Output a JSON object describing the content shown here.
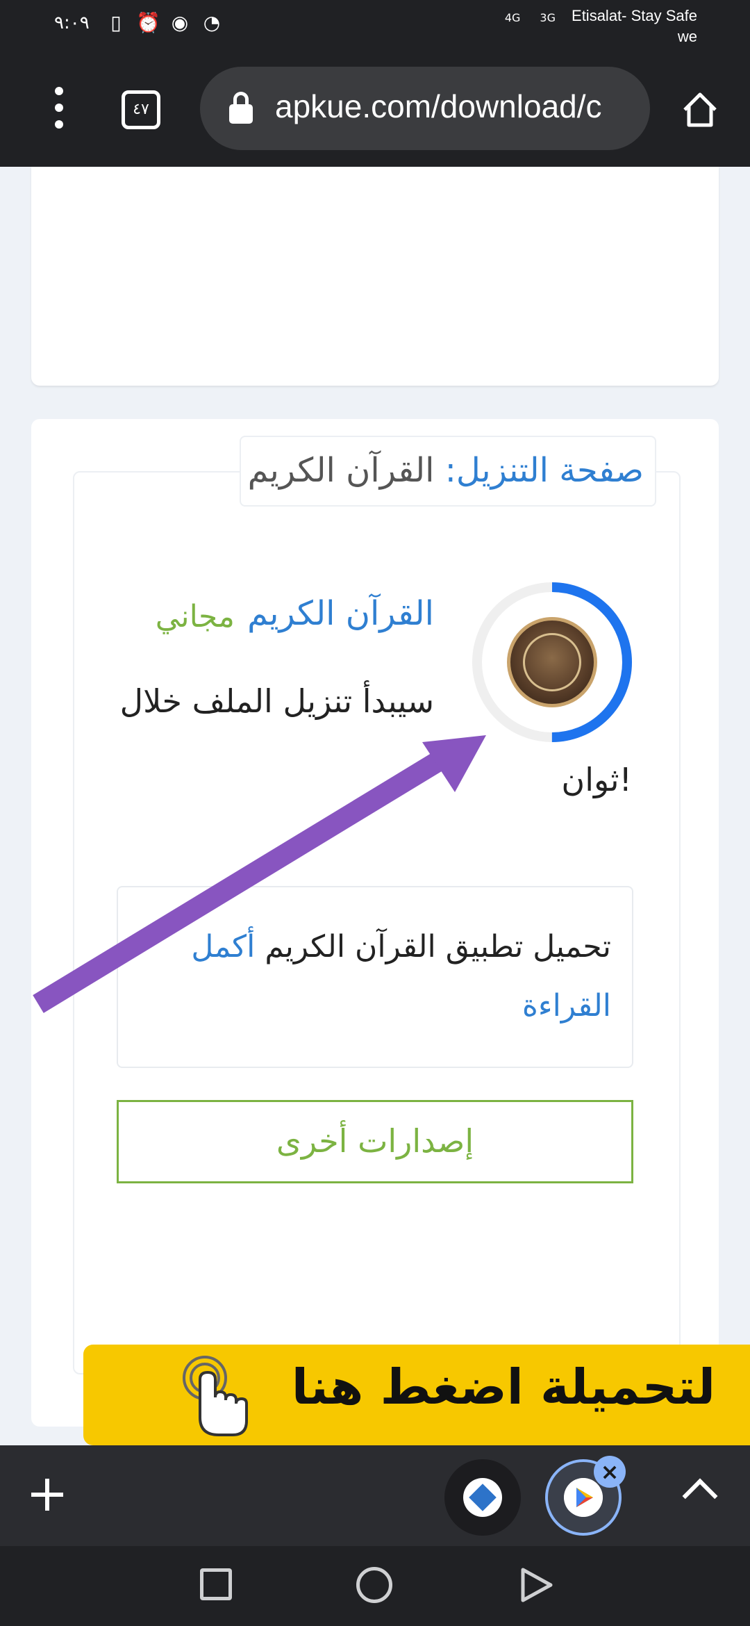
{
  "status_bar": {
    "time": "٩:٠٩",
    "network_4g": "4G",
    "network_3g": "3G",
    "carrier_line1": "Etisalat- Stay Safe",
    "carrier_line2": "we"
  },
  "browser": {
    "tab_count": "٤٧",
    "url": "apkue.com/download/c"
  },
  "download_card": {
    "legend_prefix": "صفحة التنزيل:",
    "legend_title": "القرآن الكريم",
    "app_title": "القرآن الكريم",
    "app_free_label": "مجاني",
    "countdown_line1": "سيبدأ تنزيل الملف خلال",
    "countdown_line2": "ثوان!",
    "description_text": "تحميل تطبيق القرآن الكريم",
    "read_more_part1": "أكمل",
    "read_more_part2": "القراءة",
    "other_versions_label": "إصدارات أخرى",
    "progress_fraction": 0.5
  },
  "ad_banner": {
    "text": "لتحميلة اضغط هنا"
  },
  "colors": {
    "accent_blue": "#2f7fd1",
    "accent_green": "#7cb342",
    "annotation_arrow": "#8855c0",
    "ad_yellow": "#f7c800"
  },
  "icons": {
    "menu": "more-vert-icon",
    "lock": "lock-icon",
    "home": "home-icon",
    "add_tab": "plus-icon",
    "close": "close-icon",
    "chevron": "chevron-up-icon"
  }
}
